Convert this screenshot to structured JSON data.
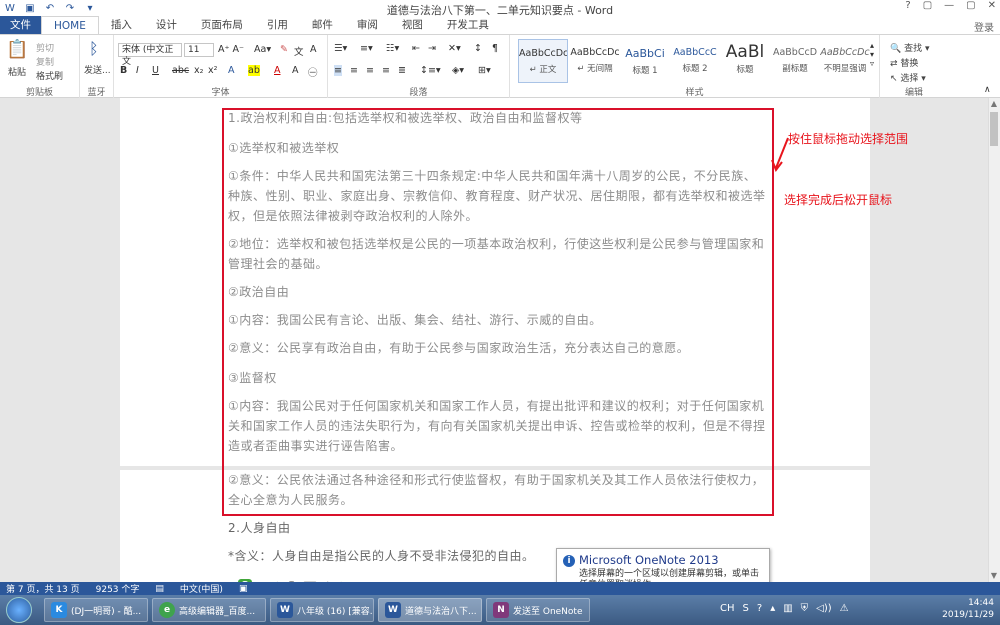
{
  "app": {
    "window_title": "道德与法治八下第一、二单元知识要点 - Word",
    "login": "登录",
    "window_controls": [
      "?",
      "▢",
      "—",
      "▢",
      "✕"
    ]
  },
  "tabs": [
    "文件",
    "HOME",
    "插入",
    "设计",
    "页面布局",
    "引用",
    "邮件",
    "审阅",
    "视图",
    "开发工具"
  ],
  "ribbon": {
    "clipboard": {
      "label": "剪贴板",
      "paste": "粘贴",
      "cut": "剪切",
      "copy": "复制",
      "format_painter": "格式刷"
    },
    "bluetooth": {
      "label": "蓝牙",
      "send": "发送..."
    },
    "font": {
      "label": "字体",
      "font_name": "宋体 (中文正文",
      "font_size": "11"
    },
    "paragraph": {
      "label": "段落"
    },
    "styles": {
      "label": "样式",
      "items": [
        {
          "preview": "AaBbCcDc",
          "name": "↵ 正文"
        },
        {
          "preview": "AaBbCcDc",
          "name": "↵ 无间隔"
        },
        {
          "preview": "AaBbCi",
          "name": "标题 1"
        },
        {
          "preview": "AaBbCcC",
          "name": "标题 2"
        },
        {
          "preview": "AaBl",
          "name": "标题"
        },
        {
          "preview": "AaBbCcD",
          "name": "副标题"
        },
        {
          "preview": "AaBbCcDc",
          "name": "不明显强调"
        }
      ]
    },
    "editing": {
      "label": "编辑",
      "find": "查找",
      "replace": "替换",
      "select": "选择"
    }
  },
  "document": {
    "paragraphs": [
      "1.政治权利和自由:包括选举权和被选举权、政治自由和监督权等",
      "①选举权和被选举权",
      "①条件：中华人民共和国宪法第三十四条规定:中华人民共和国年满十八周岁的公民，不分民族、种族、性别、职业、家庭出身、宗教信仰、教育程度、财产状况、居住期限，都有选举权和被选举权，但是依照法律被剥夺政治权利的人除外。",
      "②地位：选举权和被包括选举权是公民的一项基本政治权利，行使这些权利是公民参与管理国家和管理社会的基础。",
      "②政治自由",
      "①内容：我国公民有言论、出版、集会、结社、游行、示威的自由。",
      "②意义：公民享有政治自由，有助于公民参与国家政治生活，充分表达自己的意愿。",
      "③监督权",
      "①内容：我国公民对于任何国家机关和国家工作人员，有提出批评和建议的权利；对于任何国家机关和国家工作人员的违法失职行为，有向有关国家机关提出申诉、控告或检举的权利，但是不得捏造或者歪曲事实进行诬告陷害。"
    ],
    "page2_paragraphs": [
      "②意义：公民依法通过各种途径和形式行使监督权，有助于国家机关及其工作人员依法行使权力，全心全意为人民服务。",
      "2.人身自由",
      "*含义：人身自由是指公民的人身不受非法侵犯的自由。"
    ]
  },
  "annotations": {
    "drag_hint": "按住鼠标拖动选择范围",
    "release_hint": "选择完成后松开鼠标",
    "color": "#e8141c"
  },
  "popup": {
    "title": "Microsoft OneNote 2013",
    "body": "选择屏幕的一个区域以创建屏幕剪辑，或单击任意位置取消操作。"
  },
  "statusbar": {
    "page": "第 7 页，共 13 页",
    "words": "9253 个字",
    "language": "中文(中国)"
  },
  "ime": {
    "logo": "S",
    "mode": "五"
  },
  "taskbar": {
    "buttons": [
      {
        "icon": "K",
        "label": "(DJ一明哥) - 酷...",
        "color": "#2b8ae0"
      },
      {
        "icon": "e",
        "label": "高级编辑器_百度...",
        "color": "#3fa34d"
      },
      {
        "icon": "W",
        "label": "八年级 (16) [兼容...",
        "color": "#2b579a"
      },
      {
        "icon": "W",
        "label": "道德与法治八下...",
        "color": "#2b579a"
      },
      {
        "icon": "N",
        "label": "发送至 OneNote",
        "color": "#80397b"
      }
    ],
    "ime_indicator": "CH",
    "time": "14:44",
    "date": "2019/11/29"
  }
}
